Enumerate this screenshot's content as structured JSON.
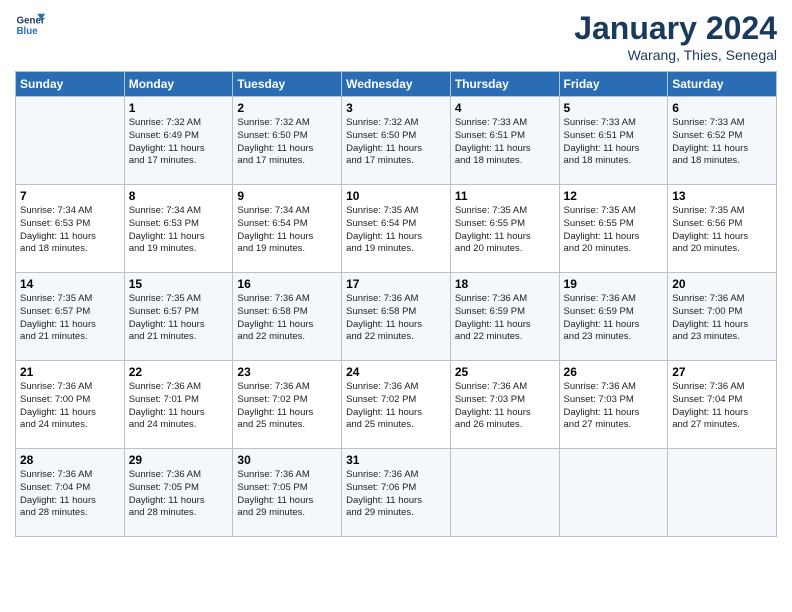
{
  "header": {
    "logo_line1": "General",
    "logo_line2": "Blue",
    "month": "January 2024",
    "location": "Warang, Thies, Senegal"
  },
  "weekdays": [
    "Sunday",
    "Monday",
    "Tuesday",
    "Wednesday",
    "Thursday",
    "Friday",
    "Saturday"
  ],
  "weeks": [
    [
      {
        "day": "",
        "info": ""
      },
      {
        "day": "1",
        "info": "Sunrise: 7:32 AM\nSunset: 6:49 PM\nDaylight: 11 hours\nand 17 minutes."
      },
      {
        "day": "2",
        "info": "Sunrise: 7:32 AM\nSunset: 6:50 PM\nDaylight: 11 hours\nand 17 minutes."
      },
      {
        "day": "3",
        "info": "Sunrise: 7:32 AM\nSunset: 6:50 PM\nDaylight: 11 hours\nand 17 minutes."
      },
      {
        "day": "4",
        "info": "Sunrise: 7:33 AM\nSunset: 6:51 PM\nDaylight: 11 hours\nand 18 minutes."
      },
      {
        "day": "5",
        "info": "Sunrise: 7:33 AM\nSunset: 6:51 PM\nDaylight: 11 hours\nand 18 minutes."
      },
      {
        "day": "6",
        "info": "Sunrise: 7:33 AM\nSunset: 6:52 PM\nDaylight: 11 hours\nand 18 minutes."
      }
    ],
    [
      {
        "day": "7",
        "info": "Sunrise: 7:34 AM\nSunset: 6:53 PM\nDaylight: 11 hours\nand 18 minutes."
      },
      {
        "day": "8",
        "info": "Sunrise: 7:34 AM\nSunset: 6:53 PM\nDaylight: 11 hours\nand 19 minutes."
      },
      {
        "day": "9",
        "info": "Sunrise: 7:34 AM\nSunset: 6:54 PM\nDaylight: 11 hours\nand 19 minutes."
      },
      {
        "day": "10",
        "info": "Sunrise: 7:35 AM\nSunset: 6:54 PM\nDaylight: 11 hours\nand 19 minutes."
      },
      {
        "day": "11",
        "info": "Sunrise: 7:35 AM\nSunset: 6:55 PM\nDaylight: 11 hours\nand 20 minutes."
      },
      {
        "day": "12",
        "info": "Sunrise: 7:35 AM\nSunset: 6:55 PM\nDaylight: 11 hours\nand 20 minutes."
      },
      {
        "day": "13",
        "info": "Sunrise: 7:35 AM\nSunset: 6:56 PM\nDaylight: 11 hours\nand 20 minutes."
      }
    ],
    [
      {
        "day": "14",
        "info": "Sunrise: 7:35 AM\nSunset: 6:57 PM\nDaylight: 11 hours\nand 21 minutes."
      },
      {
        "day": "15",
        "info": "Sunrise: 7:35 AM\nSunset: 6:57 PM\nDaylight: 11 hours\nand 21 minutes."
      },
      {
        "day": "16",
        "info": "Sunrise: 7:36 AM\nSunset: 6:58 PM\nDaylight: 11 hours\nand 22 minutes."
      },
      {
        "day": "17",
        "info": "Sunrise: 7:36 AM\nSunset: 6:58 PM\nDaylight: 11 hours\nand 22 minutes."
      },
      {
        "day": "18",
        "info": "Sunrise: 7:36 AM\nSunset: 6:59 PM\nDaylight: 11 hours\nand 22 minutes."
      },
      {
        "day": "19",
        "info": "Sunrise: 7:36 AM\nSunset: 6:59 PM\nDaylight: 11 hours\nand 23 minutes."
      },
      {
        "day": "20",
        "info": "Sunrise: 7:36 AM\nSunset: 7:00 PM\nDaylight: 11 hours\nand 23 minutes."
      }
    ],
    [
      {
        "day": "21",
        "info": "Sunrise: 7:36 AM\nSunset: 7:00 PM\nDaylight: 11 hours\nand 24 minutes."
      },
      {
        "day": "22",
        "info": "Sunrise: 7:36 AM\nSunset: 7:01 PM\nDaylight: 11 hours\nand 24 minutes."
      },
      {
        "day": "23",
        "info": "Sunrise: 7:36 AM\nSunset: 7:02 PM\nDaylight: 11 hours\nand 25 minutes."
      },
      {
        "day": "24",
        "info": "Sunrise: 7:36 AM\nSunset: 7:02 PM\nDaylight: 11 hours\nand 25 minutes."
      },
      {
        "day": "25",
        "info": "Sunrise: 7:36 AM\nSunset: 7:03 PM\nDaylight: 11 hours\nand 26 minutes."
      },
      {
        "day": "26",
        "info": "Sunrise: 7:36 AM\nSunset: 7:03 PM\nDaylight: 11 hours\nand 27 minutes."
      },
      {
        "day": "27",
        "info": "Sunrise: 7:36 AM\nSunset: 7:04 PM\nDaylight: 11 hours\nand 27 minutes."
      }
    ],
    [
      {
        "day": "28",
        "info": "Sunrise: 7:36 AM\nSunset: 7:04 PM\nDaylight: 11 hours\nand 28 minutes."
      },
      {
        "day": "29",
        "info": "Sunrise: 7:36 AM\nSunset: 7:05 PM\nDaylight: 11 hours\nand 28 minutes."
      },
      {
        "day": "30",
        "info": "Sunrise: 7:36 AM\nSunset: 7:05 PM\nDaylight: 11 hours\nand 29 minutes."
      },
      {
        "day": "31",
        "info": "Sunrise: 7:36 AM\nSunset: 7:06 PM\nDaylight: 11 hours\nand 29 minutes."
      },
      {
        "day": "",
        "info": ""
      },
      {
        "day": "",
        "info": ""
      },
      {
        "day": "",
        "info": ""
      }
    ]
  ]
}
